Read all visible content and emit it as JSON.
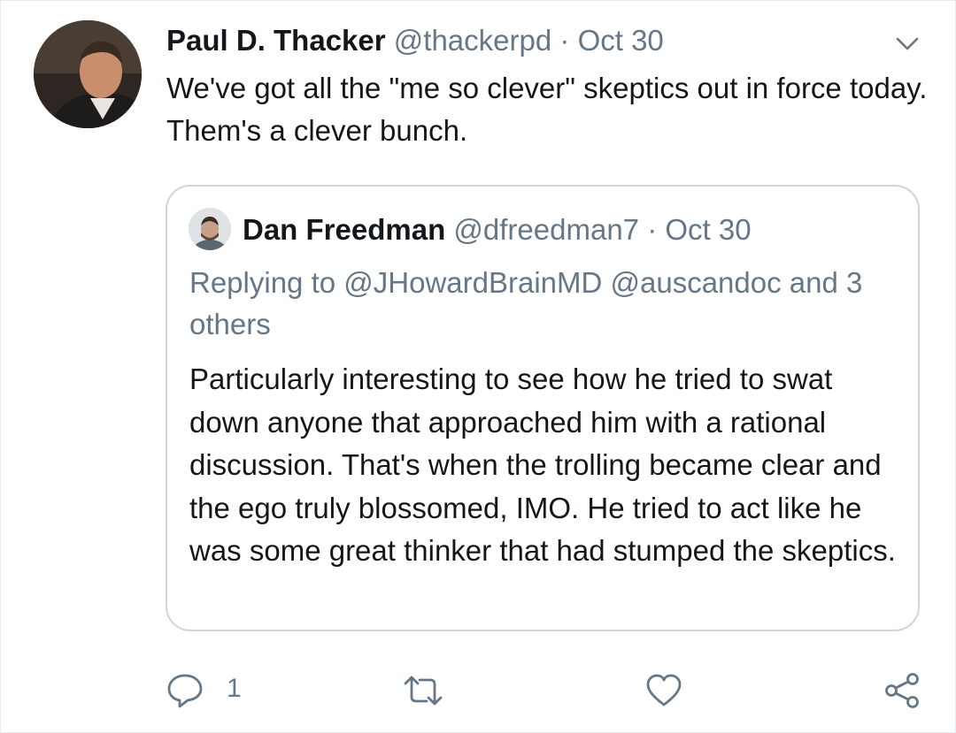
{
  "tweet": {
    "author_name": "Paul D. Thacker",
    "handle": "@thackerpd",
    "separator": "·",
    "date": "Oct 30",
    "text": "We've got all the \"me so clever\" skeptics out in force today. Them's a clever bunch."
  },
  "quoted_tweet": {
    "author_name": "Dan Freedman",
    "handle": "@dfreedman7",
    "separator": "·",
    "date": "Oct 30",
    "replying_to": "Replying to @JHowardBrainMD @auscandoc and 3 others",
    "text": "Particularly interesting to see how he tried to swat down anyone that approached him with a rational discussion. That's when the trolling became clear and the ego truly blossomed, IMO. He tried to act like he was some great thinker that had stumped the skeptics."
  },
  "actions": {
    "reply_count": "1"
  },
  "icons": {
    "menu": "chevron-down-icon",
    "reply": "reply-icon",
    "retweet": "retweet-icon",
    "like": "heart-icon",
    "share": "share-icon"
  },
  "colors": {
    "text": "#14171a",
    "muted": "#657786",
    "border": "#ccd6dd"
  }
}
